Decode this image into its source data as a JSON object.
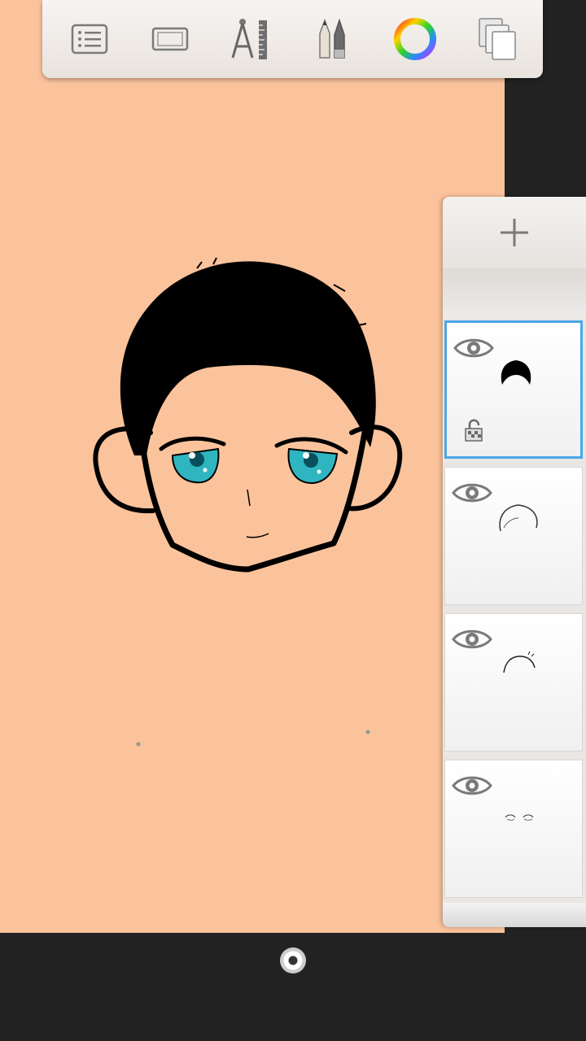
{
  "app": {
    "canvas_color": "#fbc39c",
    "accent_color": "#4aa8e8"
  },
  "toolbar": {
    "items": [
      {
        "name": "menu",
        "icon": "list-menu-icon"
      },
      {
        "name": "canvas",
        "icon": "canvas-frame-icon"
      },
      {
        "name": "guides",
        "icon": "compass-ruler-icon"
      },
      {
        "name": "brushes",
        "icon": "brushes-icon"
      },
      {
        "name": "color",
        "icon": "color-wheel-icon"
      },
      {
        "name": "layers",
        "icon": "layers-copy-icon"
      }
    ]
  },
  "layers_panel": {
    "add_icon": "plus-icon",
    "layers": [
      {
        "visible": true,
        "selected": true,
        "locked": false,
        "thumbnail": "hair-fill"
      },
      {
        "visible": true,
        "selected": false,
        "locked": false,
        "thumbnail": "hair-outline"
      },
      {
        "visible": true,
        "selected": false,
        "locked": false,
        "thumbnail": "hair-sketch"
      },
      {
        "visible": true,
        "selected": false,
        "locked": false,
        "thumbnail": "eyes-sketch"
      }
    ]
  },
  "bottom_bar": {
    "icon": "puck-handle-icon"
  }
}
